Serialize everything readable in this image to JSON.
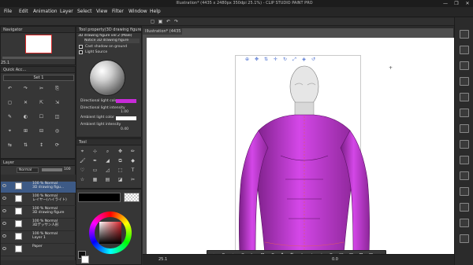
{
  "window": {
    "title": "Illustration* (4435 x 2480px 350dpi 25.1%) - CLIP STUDIO PAINT PRO",
    "controls": [
      "—",
      "❐",
      "✕"
    ]
  },
  "menu": [
    "File",
    "Edit",
    "Animation",
    "Layer",
    "Select",
    "View",
    "Filter",
    "Window",
    "Help"
  ],
  "navigator": {
    "title": "Navigator",
    "zoom": "25.1"
  },
  "tool_property": {
    "header": "Tool property(3D drawing figure ver.2 (Male))",
    "object_label": "3D drawing figure ver.2 (Male)",
    "sub_label": "Notice 3D drawing figure",
    "cast_shadow": "Cast shadow on ground",
    "light_source": "Light Source",
    "directional_color": "Directional light color",
    "directional_intensity": "Directional light intensity",
    "directional_intensity_value": "1.00",
    "ambient_color": "Ambient light color",
    "ambient_intensity": "Ambient light intensity",
    "ambient_intensity_value": "0.40",
    "directional_color_hex": "#c72bd8",
    "ambient_color_hex": "#ffffff"
  },
  "set_panel": {
    "title": "Set 1",
    "quick_access": "Quick Acc..."
  },
  "tool_panel": {
    "title": "Tool"
  },
  "layer_panel": {
    "title": "Layer",
    "blend_mode": "Normal",
    "opacity": "100",
    "layers": [
      {
        "pct": "100 % Normal",
        "name": "3D drawing figu..."
      },
      {
        "pct": "100 % Normal",
        "name": "レイヤー(ハイライト)"
      },
      {
        "pct": "100 % Normal",
        "name": "3D drawing figure"
      },
      {
        "pct": "100 % Normal",
        "name": "3Dデッサン人形"
      },
      {
        "pct": "100 % Normal",
        "name": "Layer 1"
      },
      {
        "pct": "",
        "name": "Paper"
      }
    ]
  },
  "statusbar": {
    "zoom": "25.1",
    "coords": "0.0"
  },
  "colors": {
    "figure": "#c33ad6",
    "panel": "#363636",
    "accent": "#c72bd8"
  }
}
